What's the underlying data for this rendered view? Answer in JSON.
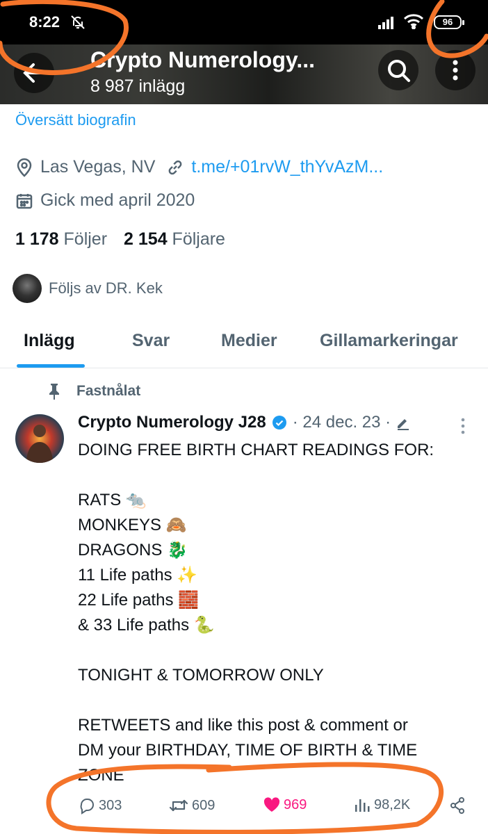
{
  "status_bar": {
    "time": "8:22",
    "battery": "96"
  },
  "header": {
    "title": "Crypto Numerology...",
    "post_count": "8 987 inlägg"
  },
  "profile": {
    "translate_bio": "Översätt biografin",
    "location": "Las Vegas, NV",
    "link": "t.me/+01rvW_thYvAzM...",
    "joined": "Gick med april 2020",
    "following_count": "1 178",
    "following_label": "Följer",
    "followers_count": "2 154",
    "followers_label": "Följare",
    "followed_by": "Följs av DR. Kek"
  },
  "tabs": [
    "Inlägg",
    "Svar",
    "Medier",
    "Gillamarkeringar"
  ],
  "post": {
    "pinned_label": "Fastnålat",
    "author": "Crypto Numerology J28",
    "meta": "· 24 dec. 23 ·",
    "text": "DOING FREE BIRTH CHART READINGS FOR:\n\nRATS 🐀\nMONKEYS 🙈\nDRAGONS 🐉\n11 Life paths ✨\n22 Life paths 🧱\n& 33 Life paths 🐍\n\nTONIGHT & TOMORROW ONLY\n\nRETWEETS and like this post & comment or\nDM your BIRTHDAY, TIME OF BIRTH & TIME\nZONE",
    "replies": "303",
    "reposts": "609",
    "likes": "969",
    "views": "98,2K"
  },
  "colors": {
    "accent": "#1d9bf0",
    "like": "#f91880",
    "annotation": "#f4742a"
  }
}
